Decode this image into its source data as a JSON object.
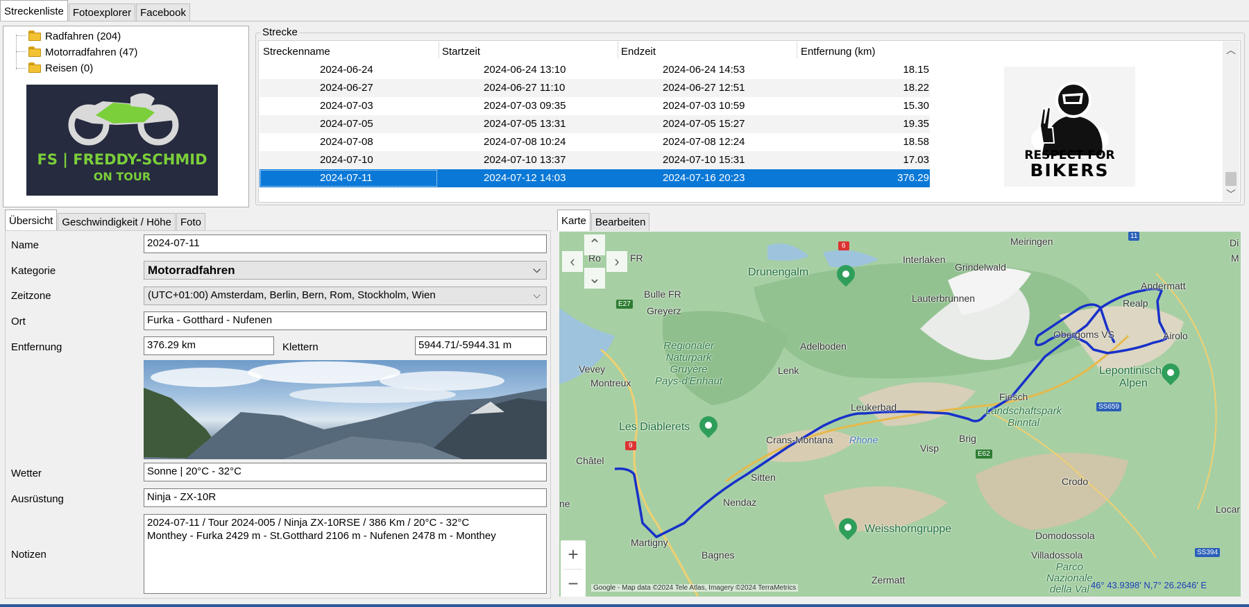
{
  "top_tabs": [
    "Streckenliste",
    "Fotoexplorer",
    "Facebook"
  ],
  "tree": [
    {
      "label": "Radfahren (204)"
    },
    {
      "label": "Motorradfahren (47)"
    },
    {
      "label": "Reisen (0)"
    }
  ],
  "logo": {
    "line1": "FS | FREDDY-SCHMID",
    "line2": "ON TOUR"
  },
  "routes": {
    "group_title": "Strecke",
    "columns": [
      "Streckenname",
      "Startzeit",
      "Endzeit",
      "Entfernung (km)"
    ],
    "rows": [
      {
        "name": "2024-06-24",
        "start": "2024-06-24 13:10",
        "end": "2024-06-24 14:53",
        "dist": "18.15"
      },
      {
        "name": "2024-06-27",
        "start": "2024-06-27 11:10",
        "end": "2024-06-27 12:51",
        "dist": "18.22"
      },
      {
        "name": "2024-07-03",
        "start": "2024-07-03 09:35",
        "end": "2024-07-03 10:59",
        "dist": "15.30"
      },
      {
        "name": "2024-07-05",
        "start": "2024-07-05 13:31",
        "end": "2024-07-05 15:27",
        "dist": "19.35"
      },
      {
        "name": "2024-07-08",
        "start": "2024-07-08 10:24",
        "end": "2024-07-08 12:24",
        "dist": "18.58"
      },
      {
        "name": "2024-07-10",
        "start": "2024-07-10 13:37",
        "end": "2024-07-10 15:31",
        "dist": "17.03"
      },
      {
        "name": "2024-07-11",
        "start": "2024-07-12 14:03",
        "end": "2024-07-16 20:23",
        "dist": "376.29"
      }
    ]
  },
  "sticker": {
    "line1": "RESPECT FOR",
    "line2": "BIKERS"
  },
  "detail_tabs": [
    "Übersicht",
    "Geschwindigkeit / Höhe",
    "Foto"
  ],
  "form": {
    "name_label": "Name",
    "name": "2024-07-11",
    "category_label": "Kategorie",
    "category": "Motorradfahren",
    "timezone_label": "Zeitzone",
    "timezone": "(UTC+01:00) Amsterdam, Berlin, Bern, Rom, Stockholm, Wien",
    "place_label": "Ort",
    "place": "Furka - Gotthard - Nufenen",
    "distance_label": "Entfernung",
    "distance": "376.29 km",
    "climb_label": "Klettern",
    "climb": "5944.71/-5944.31 m",
    "weather_label": "Wetter",
    "weather": "Sonne | 20°C - 32°C",
    "gear_label": "Ausrüstung",
    "gear": "Ninja - ZX-10R",
    "notes_label": "Notizen",
    "notes_line1": "2024-07-11 / Tour 2024-005 / Ninja ZX-10RSE / 386 Km / 20°C - 32°C",
    "notes_line2": "Monthey - Furka 2429 m - St.Gotthard 2106 m - Nufenen 2478 m - Monthey"
  },
  "map_tabs": [
    "Karte",
    "Bearbeiten"
  ],
  "map": {
    "labels": {
      "meiringen": "Meiringen",
      "interlaken": "Interlaken",
      "drunengalm": "Drunengalm",
      "grindelwald": "Grindelwald",
      "andermatt": "Andermatt",
      "realp": "Realp",
      "airolo": "Airolo",
      "bulle": "Bulle FR",
      "greyerz": "Greyerz",
      "lauterbrunnen": "Lauterbrunnen",
      "adelboden": "Adelboden",
      "lenk": "Lenk",
      "obergoms": "Obergoms VS",
      "lepontinische": "Lepontinische\nAlpen",
      "vevey": "Vevey",
      "montreux": "Montreux",
      "naturpark": "Regionaler\nNaturpark\nGruyère\nPays-d'Enhaut",
      "leukerbad": "Leukerbad",
      "fiesch": "Fiesch",
      "binntal": "Landschaftspark\nBinntal",
      "diablerets": "Les Diablerets",
      "crans": "Crans-Montana",
      "rhone": "Rhone",
      "visp": "Visp",
      "brig": "Brig",
      "chatel": "Châtel",
      "sitten": "Sitten",
      "nendaz": "Nendaz",
      "crodo": "Crodo",
      "weisshorn": "Weisshorngruppe",
      "domodossola": "Domodossola",
      "martigny": "Martigny",
      "bagnes": "Bagnes",
      "villadossola": "Villadossola",
      "parco": "Parco\nNazionale\ndella Val",
      "zermatt": "Zermatt",
      "locarno": "Locar",
      "fr": "FR",
      "ro": "Ro",
      "ne": "ne",
      "mi": "M",
      "di": "Di"
    },
    "roads": {
      "e27": "E27",
      "e62": "E62",
      "ss659": "SS659",
      "ss394": "SS394",
      "r6": "6",
      "r9": "9",
      "r11": "11"
    },
    "attribution": "Google - Map data ©2024 Tele Atlas, Imagery ©2024 TerraMetrics",
    "coords": "46° 43.9398' N,7° 26.2646' E",
    "zoom_in": "+",
    "zoom_out": "−"
  }
}
